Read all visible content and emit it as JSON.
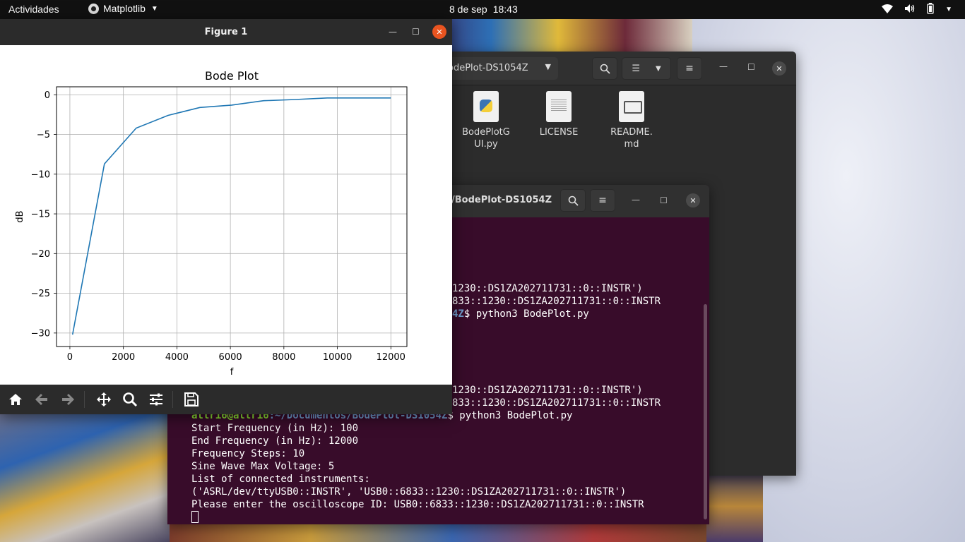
{
  "topbar": {
    "activities": "Actividades",
    "app_name": "Matplotlib",
    "date": "8 de sep",
    "time": "18:43"
  },
  "files_window": {
    "path_label": "odePlot-DS1054Z",
    "files": [
      {
        "name_line1": "BodePlotG",
        "name_line2": "UI.py",
        "icon": "python-file-icon"
      },
      {
        "name_line1": "LICENSE",
        "name_line2": "",
        "icon": "text-file-icon"
      },
      {
        "name_line1": "README.",
        "name_line2": "md",
        "icon": "markdown-file-icon"
      }
    ]
  },
  "terminal_window": {
    "title": "/BodePlot-DS1054Z",
    "partial_lines": [
      "1230::DS1ZA202711731::0::INSTR')",
      "833::1230::DS1ZA202711731::0::INSTR",
      "$ python3 BodePlot.py",
      "1230::DS1ZA202711731::0::INSTR')",
      "833::1230::DS1ZA202711731::0::INSTR"
    ],
    "prompt_tail": "4Z",
    "prompt_user": "altri6@altri6",
    "prompt_path": ":~/Documentos/BodePlot-DS1054Z",
    "command": "$ python3 BodePlot.py",
    "lines": [
      "Start Frequency (in Hz): 100",
      "End Frequency (in Hz): 12000",
      "Frequency Steps: 10",
      "Sine Wave Max Voltage: 5",
      "List of connected instruments:",
      "('ASRL/dev/ttyUSB0::INSTR', 'USB0::6833::1230::DS1ZA202711731::0::INSTR')",
      "Please enter the oscilloscope ID: USB0::6833::1230::DS1ZA202711731::0::INSTR"
    ]
  },
  "figure_window": {
    "title": "Figure 1",
    "toolbar": [
      "home-icon",
      "back-arrow-icon",
      "forward-arrow-icon",
      "pan-move-icon",
      "zoom-magnifier-icon",
      "configure-subplots-icon",
      "save-floppy-icon"
    ]
  },
  "chart_data": {
    "type": "line",
    "title": "Bode Plot",
    "xlabel": "f",
    "ylabel": "dB",
    "x": [
      100,
      1290,
      2480,
      3670,
      4860,
      6050,
      7240,
      8430,
      9620,
      10810,
      12000
    ],
    "y": [
      -30.2,
      -8.7,
      -4.2,
      -2.6,
      -1.6,
      -1.3,
      -0.75,
      -0.6,
      -0.4,
      -0.4,
      -0.4
    ],
    "xlim": [
      -500,
      12600
    ],
    "ylim": [
      -31.7,
      1.0
    ],
    "xticks": [
      0,
      2000,
      4000,
      6000,
      8000,
      10000,
      12000
    ],
    "xtick_labels": [
      "0",
      "2000",
      "4000",
      "6000",
      "8000",
      "10000",
      "12000"
    ],
    "yticks": [
      0,
      -5,
      -10,
      -15,
      -20,
      -25,
      -30
    ],
    "ytick_labels": [
      "0",
      "−5",
      "−10",
      "−15",
      "−20",
      "−25",
      "−30"
    ],
    "grid": true,
    "line_color": "#1f77b4"
  }
}
